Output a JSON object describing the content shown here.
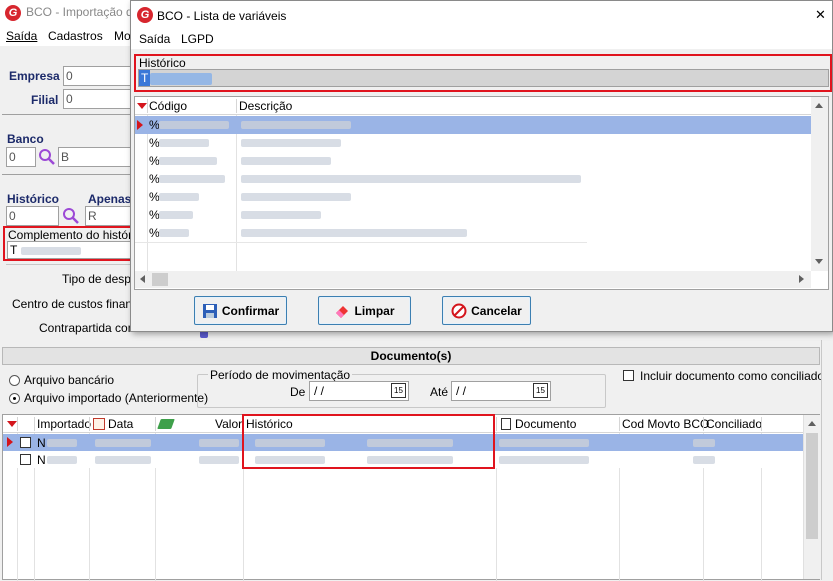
{
  "bg_window": {
    "title": "BCO - Importação d",
    "menu": [
      "Saída",
      "Cadastros",
      "Mo"
    ],
    "empresa_label": "Empresa",
    "empresa_value": "0",
    "filial_label": "Filial",
    "filial_value": "0",
    "banco_label": "Banco",
    "banco_code": "0",
    "banco_name": "B",
    "historico_label": "Histórico",
    "apenas_label": "Apenas",
    "historico_value": "0",
    "apenas_value": "R",
    "complemento_label": "Complemento do histórico",
    "complemento_value": "T",
    "tipo_despesa_label": "Tipo de despe",
    "centro_custos_label": "Centro de custos finance",
    "contrapartida_label": "Contrapartida contá",
    "documentos_title": "Documento(s)",
    "radio_arquivo_bancario": "Arquivo bancário",
    "radio_arquivo_importado": "Arquivo importado (Anteriormente)",
    "periodo_title": "Período de movimentação",
    "de_label": "De",
    "de_value": "/ /",
    "ate_label": "Até",
    "ate_value": "/ /",
    "calendar_label": "15",
    "incluir_label": "Incluir documento como conciliado",
    "grid_headers": [
      "Importado",
      "Data",
      "Valor",
      "Histórico",
      "Documento",
      "Cod Movto BCO",
      "Conciliado"
    ],
    "grid_rows": [
      {
        "importado": "N"
      },
      {
        "importado": "N"
      }
    ]
  },
  "dialog": {
    "title": "BCO - Lista de variáveis",
    "close_label": "✕",
    "menu": [
      "Saída",
      "LGPD"
    ],
    "historico_label": "Histórico",
    "historico_value": "T",
    "col_codigo": "Código",
    "col_descricao": "Descrição",
    "row_prefix": "%",
    "confirm_label": "Confirmar",
    "limpar_label": "Limpar",
    "cancel_label": "Cancelar"
  }
}
